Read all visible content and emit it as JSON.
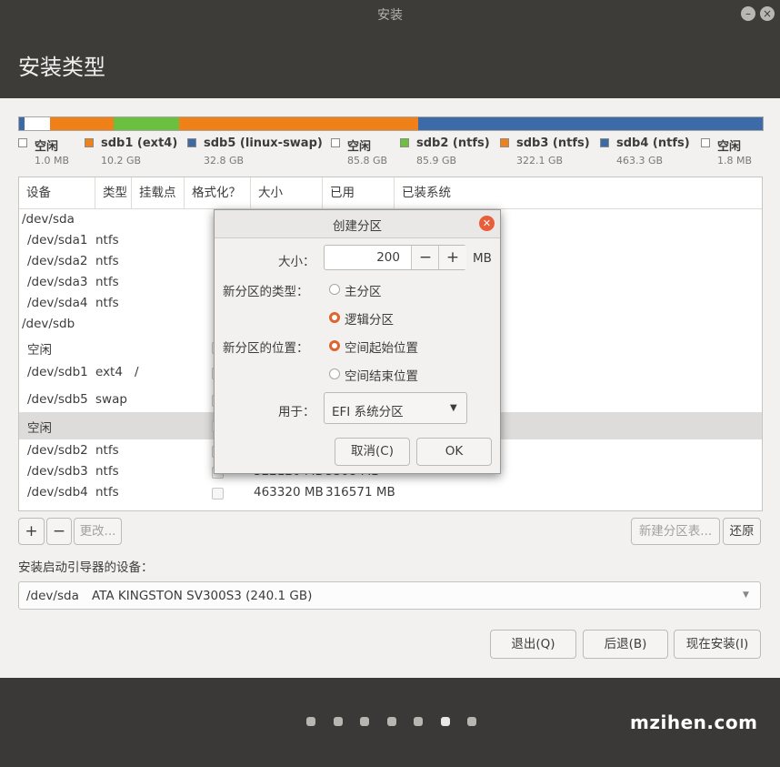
{
  "window": {
    "title": "安装",
    "minimize_glyph": "–",
    "close_glyph": "×"
  },
  "page": {
    "title": "安装类型"
  },
  "partition_bar": [
    {
      "color": "#3c6aa6"
    },
    {
      "color": "#ffffff"
    },
    {
      "color": "#f08119"
    },
    {
      "color": "#4a70a8"
    },
    {
      "color": "#ffffff"
    },
    {
      "color": "#6cc040"
    },
    {
      "color": "#f08119"
    },
    {
      "color": "#3d6aa8"
    },
    {
      "color": "#ffffff"
    }
  ],
  "legend": [
    {
      "name": "空闲",
      "size": "1.0 MB",
      "color": "#ffffff"
    },
    {
      "name": "sdb1 (ext4)",
      "size": "10.2 GB",
      "color": "#f08119"
    },
    {
      "name": "sdb5 (linux-swap)",
      "size": "32.8 GB",
      "color": "#3c6aa6"
    },
    {
      "name": "空闲",
      "size": "85.8 GB",
      "color": "#ffffff"
    },
    {
      "name": "sdb2 (ntfs)",
      "size": "85.9 GB",
      "color": "#6cc040"
    },
    {
      "name": "sdb3 (ntfs)",
      "size": "322.1 GB",
      "color": "#f08119"
    },
    {
      "name": "sdb4 (ntfs)",
      "size": "463.3 GB",
      "color": "#3c6aa6"
    },
    {
      "name": "空闲",
      "size": "1.8 MB",
      "color": "#ffffff"
    }
  ],
  "table": {
    "headers": [
      "设备",
      "类型",
      "挂载点",
      "格式化？",
      "大小",
      "已用",
      "已装系统"
    ],
    "rows": [
      {
        "device": "/dev/sda",
        "type": "",
        "mount": "",
        "size": "",
        "used": "",
        "checkbox": false
      },
      {
        "device": "/dev/sda1",
        "type": "ntfs",
        "mount": "",
        "size": "",
        "used": "",
        "checkbox": false
      },
      {
        "device": "/dev/sda2",
        "type": "ntfs",
        "mount": "",
        "size": "",
        "used": "",
        "checkbox": false
      },
      {
        "device": "/dev/sda3",
        "type": "ntfs",
        "mount": "",
        "size": "",
        "used": "",
        "checkbox": false
      },
      {
        "device": "/dev/sda4",
        "type": "ntfs",
        "mount": "",
        "size": "",
        "used": "",
        "checkbox": false
      },
      {
        "device": "/dev/sdb",
        "type": "",
        "mount": "",
        "size": "",
        "used": "",
        "checkbox": false
      },
      {
        "device": "空闲",
        "type": "",
        "mount": "",
        "size": "",
        "used": "",
        "checkbox": false
      },
      {
        "device": "/dev/sdb1",
        "type": "ext4",
        "mount": "/",
        "size": "",
        "used": "",
        "checkbox": false
      },
      {
        "device": "/dev/sdb5",
        "type": "swap",
        "mount": "",
        "size": "",
        "used": "",
        "checkbox": false
      },
      {
        "device": "空闲",
        "type": "",
        "mount": "",
        "size": "",
        "used": "",
        "checkbox": false
      },
      {
        "device": "/dev/sdb2",
        "type": "ntfs",
        "mount": "",
        "size": "",
        "used": "",
        "checkbox": false
      },
      {
        "device": "/dev/sdb3",
        "type": "ntfs",
        "mount": "",
        "size": "322120 MB",
        "used": "5308 MB",
        "checkbox": false
      },
      {
        "device": "/dev/sdb4",
        "type": "ntfs",
        "mount": "",
        "size": "463320 MB",
        "used": "316571 MB",
        "checkbox": false
      }
    ]
  },
  "toolbar": {
    "add": "+",
    "remove": "−",
    "change": "更改...",
    "new_table": "新建分区表...",
    "revert": "还原"
  },
  "bootloader": {
    "label": "安装启动引导器的设备：",
    "device": "/dev/sda",
    "description": "ATA KINGSTON SV300S3 (240.1 GB)"
  },
  "buttons": {
    "quit": "退出(Q)",
    "back": "后退(B)",
    "install": "现在安装(I)"
  },
  "dialog": {
    "title": "创建分区",
    "size_label": "大小：",
    "size_value": "200",
    "size_unit": "MB",
    "minus": "−",
    "plus": "+",
    "type_label": "新分区的类型：",
    "type_primary": "主分区",
    "type_logical": "逻辑分区",
    "type_selected": "logical",
    "location_label": "新分区的位置：",
    "location_begin": "空间起始位置",
    "location_end": "空间结束位置",
    "location_selected": "begin",
    "use_label": "用于：",
    "use_value": "EFI 系统分区",
    "cancel": "取消(C)",
    "ok": "OK"
  },
  "progress_steps": {
    "total": 7,
    "current": 6
  },
  "watermark": "mzihen.com"
}
